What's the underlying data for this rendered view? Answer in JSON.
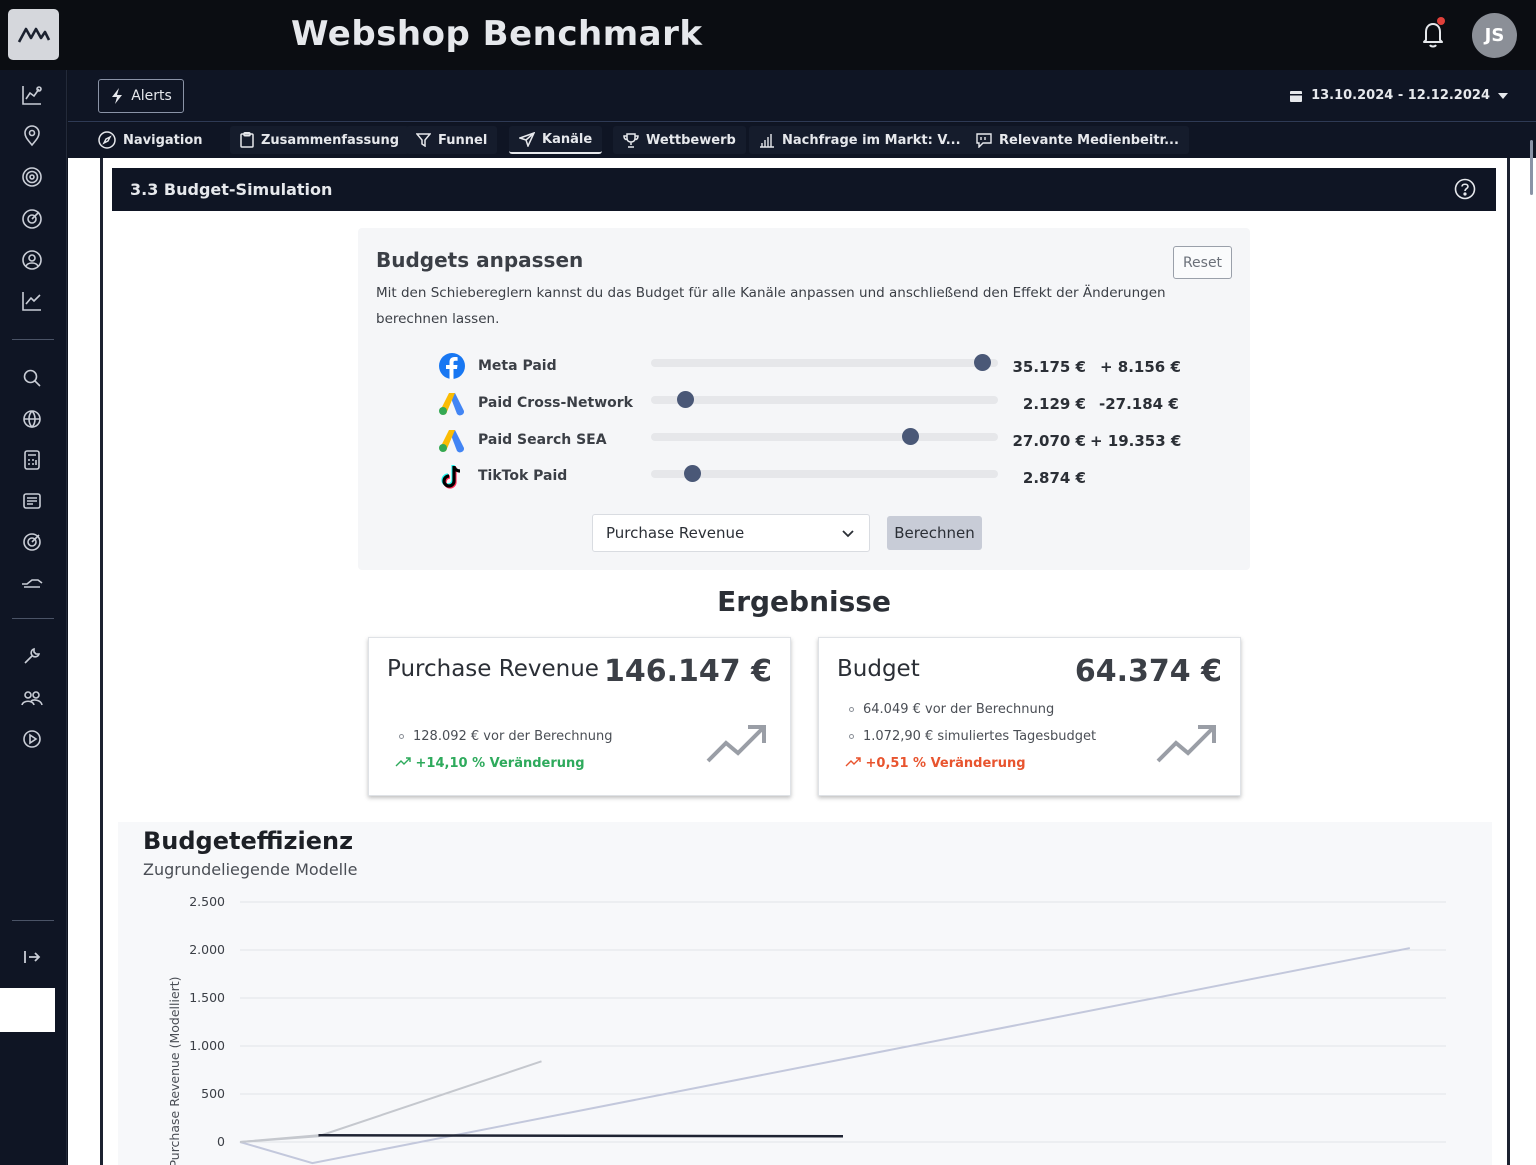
{
  "app": {
    "title": "Webshop Benchmark",
    "user_initials": "JS",
    "notifications_badge": true
  },
  "toolbar": {
    "alerts_label": "Alerts",
    "date_range": "13.10.2024 - 12.12.2024"
  },
  "tabs": [
    {
      "label": "Navigation",
      "icon": "compass-icon"
    },
    {
      "label": "Zusammenfassung",
      "icon": "clipboard-icon"
    },
    {
      "label": "Funnel",
      "icon": "filter-icon"
    },
    {
      "label": "Kanäle",
      "icon": "send-icon",
      "active": true
    },
    {
      "label": "Wettbewerb",
      "icon": "trophy-icon"
    },
    {
      "label": "Nachfrage im Markt: V...",
      "icon": "bar-chart-icon"
    },
    {
      "label": "Relevante Medienbeitr...",
      "icon": "quote-icon"
    }
  ],
  "sidebar": {
    "items": [
      "analytics-icon",
      "location-icon",
      "target-icon",
      "compass-target-icon",
      "user-search-icon",
      "trend-chart-icon",
      "search-icon",
      "globe-icon",
      "calculator-icon",
      "news-icon",
      "goal-icon",
      "handshake-icon",
      "wrench-icon",
      "team-icon",
      "play-icon"
    ],
    "collapse_icon": "collapse-icon"
  },
  "panel": {
    "title": "3.3 Budget-Simulation"
  },
  "budgets": {
    "title": "Budgets anpassen",
    "description": "Mit den Schiebereglern kannst du das Budget für alle Kanäle anpassen und anschließend den Effekt der Änderungen berechnen lassen.",
    "reset_label": "Reset",
    "channels": [
      {
        "name": "Meta Paid",
        "icon": "facebook-icon",
        "value": "35.175 €",
        "delta": "+ 8.156 €",
        "slider_fraction": 0.98
      },
      {
        "name": "Paid Cross-Network",
        "icon": "google-ads-icon",
        "value": "2.129 €",
        "delta": "-27.184 €",
        "slider_fraction": 0.08
      },
      {
        "name": "Paid Search SEA",
        "icon": "google-ads-icon",
        "value": "27.070 €",
        "delta": "+ 19.353 €",
        "slider_fraction": 0.76
      },
      {
        "name": "TikTok Paid",
        "icon": "tiktok-icon",
        "value": "2.874 €",
        "delta": "",
        "slider_fraction": 0.1
      }
    ],
    "metric_select": "Purchase Revenue",
    "calculate_label": "Berechnen"
  },
  "results": {
    "title": "Ergebnisse",
    "cards": [
      {
        "title": "Purchase Revenue",
        "value": "146.147 €",
        "lines": [
          "128.092 € vor der Berechnung"
        ],
        "change": "+14,10 % Veränderung",
        "change_color": "#2eaa5c"
      },
      {
        "title": "Budget",
        "value": "64.374 €",
        "lines": [
          "64.049 € vor der Berechnung",
          "1.072,90 € simuliertes Tagesbudget"
        ],
        "change": "+0,51 % Veränderung",
        "change_color": "#e8542e"
      }
    ]
  },
  "efficiency": {
    "title": "Budgeteffizienz",
    "subtitle": "Zugrundeliegende Modelle"
  },
  "chart_data": {
    "type": "line",
    "title": "",
    "ylabel": "Purchase Revenue (Modelliert)",
    "xlabel": "",
    "ylim": [
      0,
      2500
    ],
    "yticks": [
      "0",
      "500",
      "1.000",
      "1.500",
      "2.000",
      "2.500"
    ],
    "grid": true,
    "series": [
      {
        "color": "#c5c8ce",
        "x": [
          0,
          6.5,
          25
        ],
        "y": [
          0,
          60,
          840
        ]
      },
      {
        "color": "#c3c8dc",
        "x": [
          0,
          6,
          97
        ],
        "y": [
          0,
          -220,
          2020
        ]
      },
      {
        "color": "#1f2433",
        "x": [
          6.5,
          50
        ],
        "y": [
          70,
          60
        ]
      },
      {
        "color": "#c5c8ce",
        "x": [
          0,
          6.5
        ],
        "y": [
          0,
          70
        ]
      }
    ],
    "xlim": [
      0,
      100
    ]
  }
}
